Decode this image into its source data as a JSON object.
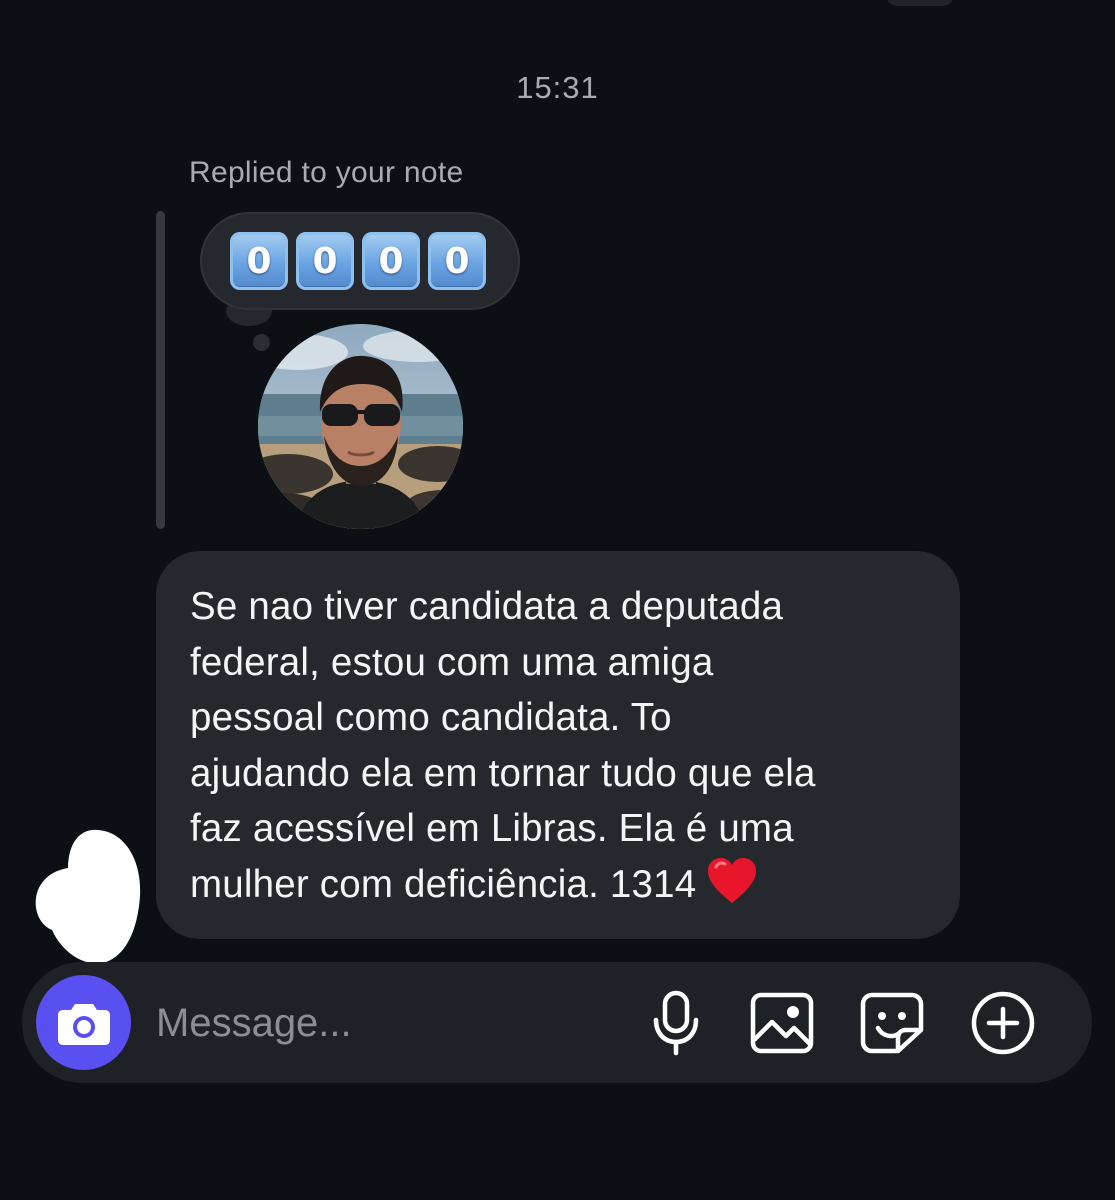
{
  "thread": {
    "timestamp": "15:31",
    "reply_context": "Replied to your note"
  },
  "note": {
    "keycap_digits": [
      "0",
      "0",
      "0",
      "0"
    ],
    "keycap_color": "#6aa4e3"
  },
  "message": {
    "text": "Se nao tiver candidata a deputada\nfederal, estou com uma amiga\npessoal como candidata. To\najudando ela em tornar tudo que ela\nfaz acessível em Libras. Ela é uma\nmulher com deficiência. 1314",
    "trailing_emoji": "red-heart"
  },
  "composer": {
    "placeholder": "Message...",
    "camera_button_color": "#5a4ff0",
    "icons": [
      "microphone-icon",
      "image-icon",
      "sticker-icon",
      "plus-circle-icon"
    ]
  },
  "theme": {
    "background": "#0c1014",
    "bubble": "#25292e",
    "secondary_text": "#a8acb2"
  }
}
